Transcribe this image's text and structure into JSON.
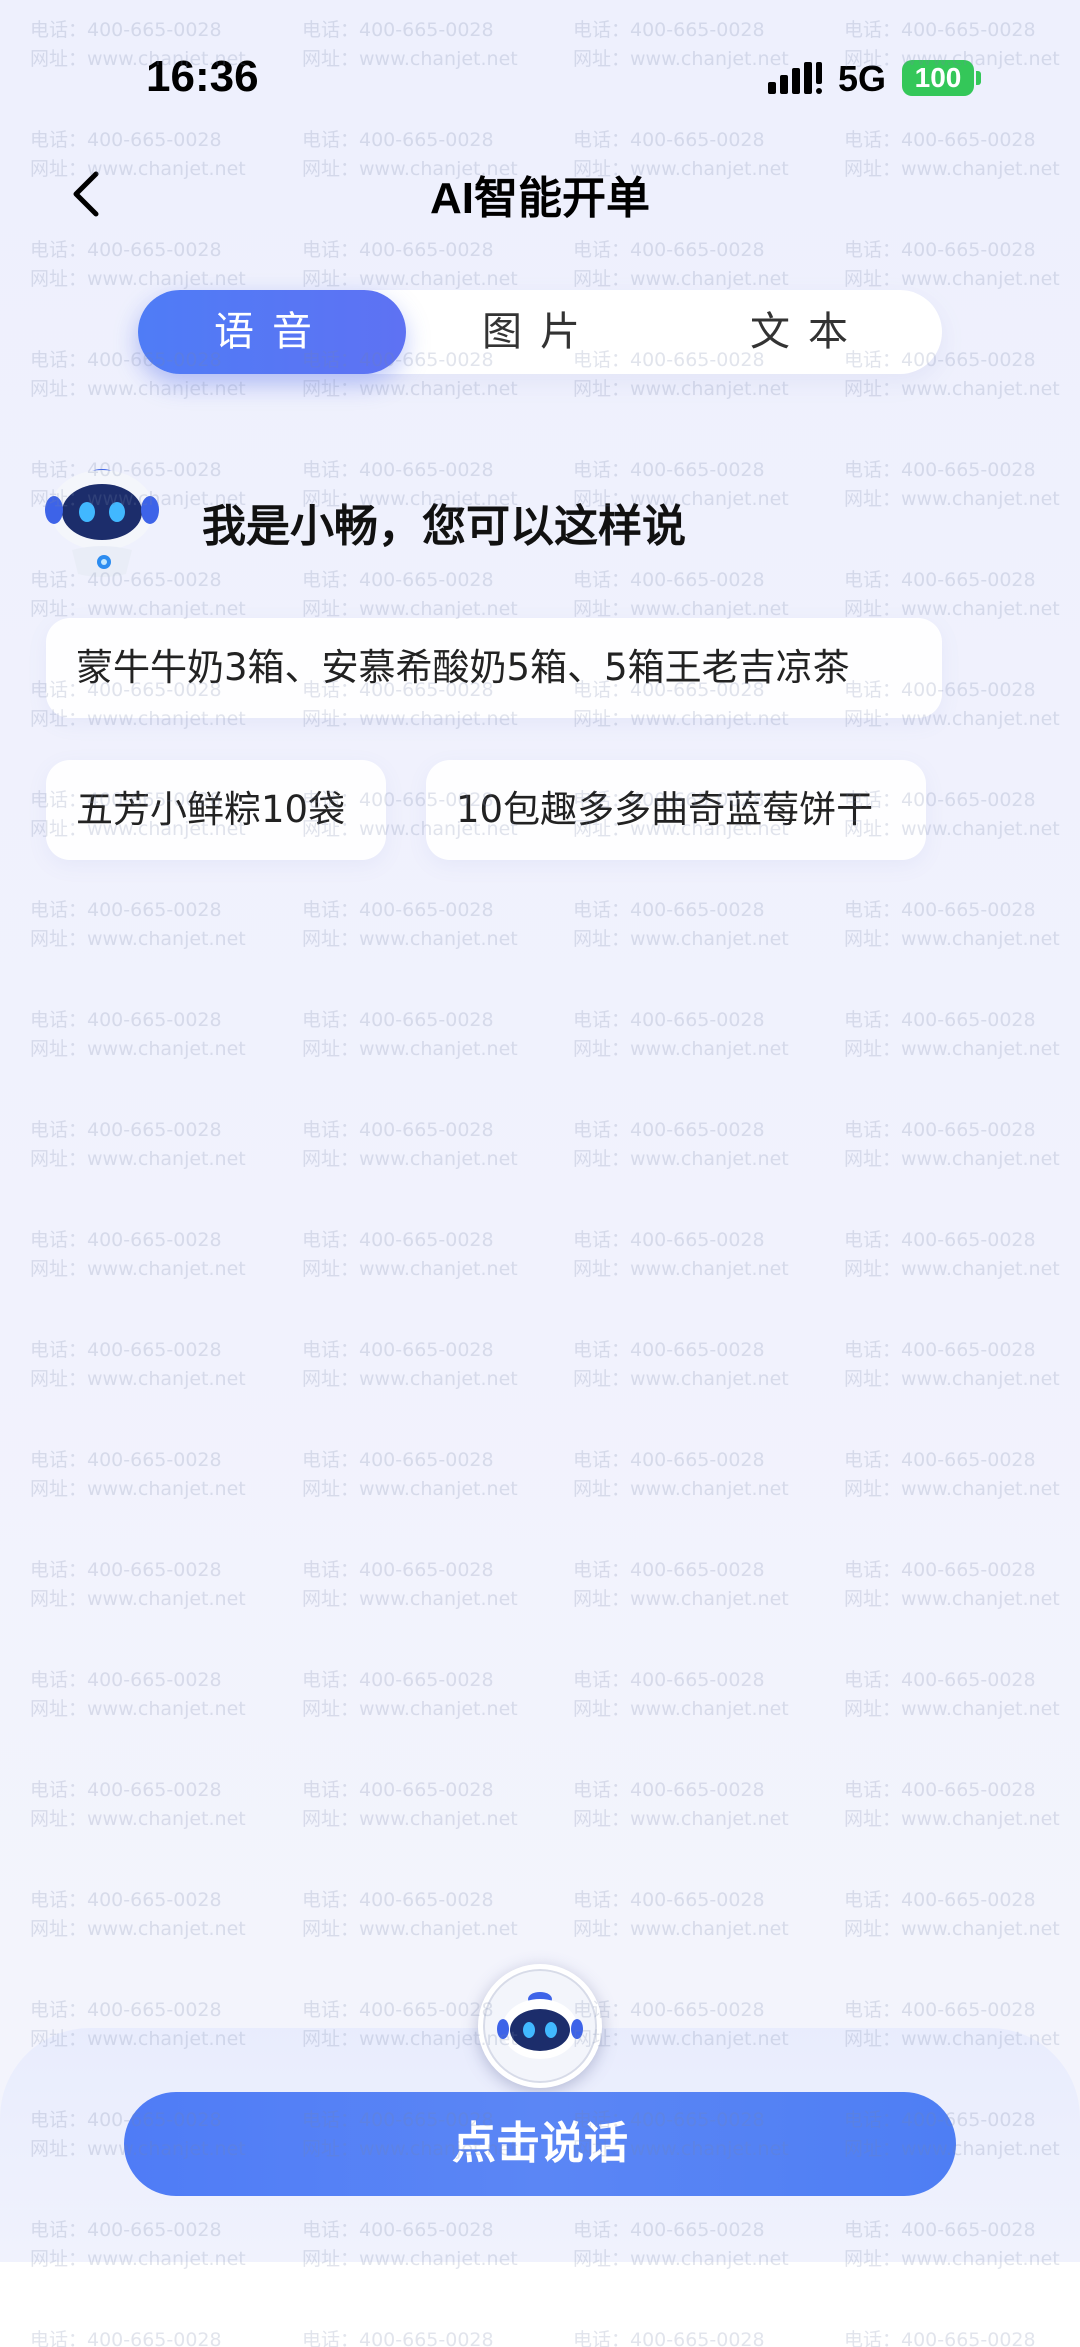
{
  "status_bar": {
    "time": "16:36",
    "network": "5G",
    "battery": "100",
    "icons": [
      "signal-icon",
      "battery-icon"
    ]
  },
  "nav": {
    "back_icon": "chevron-left-icon",
    "title": "AI智能开单"
  },
  "tabs": [
    {
      "label": "语音",
      "active": true
    },
    {
      "label": "图片",
      "active": false
    },
    {
      "label": "文本",
      "active": false
    }
  ],
  "greeting": {
    "avatar_icon": "robot-icon",
    "text": "我是小畅，您可以这样说"
  },
  "suggestions": [
    "蒙牛牛奶3箱、安慕希酸奶5箱、5箱王老吉凉茶",
    "五芳小鲜粽10袋",
    "10包趣多多曲奇蓝莓饼干"
  ],
  "bottom": {
    "mic_icon": "robot-icon",
    "talk_label": "点击说话"
  },
  "watermark": {
    "line1": "电话：400-665-0028",
    "line2": "网址：www.chanjet.net"
  },
  "colors": {
    "accent": "#4f7cf6",
    "battery": "#34c759",
    "background": "#eef0fd"
  }
}
